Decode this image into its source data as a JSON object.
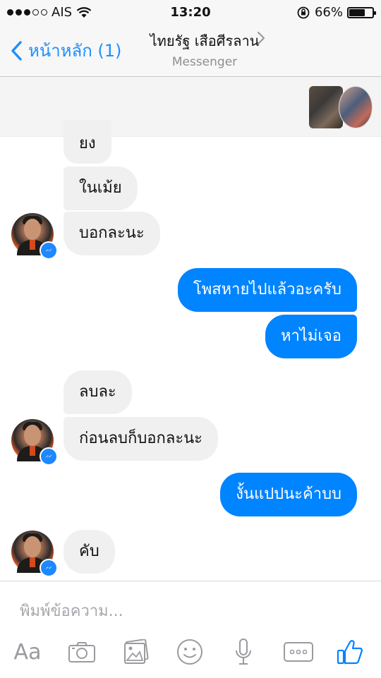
{
  "status_bar": {
    "carrier": "AIS",
    "time": "13:20",
    "battery": "66%"
  },
  "nav": {
    "back_label": "หน้าหลัก (1)",
    "title": "ไทยรัฐ เสือศีรลาน",
    "subtitle": "Messenger"
  },
  "messages": [
    {
      "dir": "in",
      "text": "ยง"
    },
    {
      "dir": "in",
      "text": "ในเม้ย"
    },
    {
      "dir": "in",
      "text": "บอกละนะ"
    },
    {
      "dir": "out",
      "text": "โพสหายไปแล้วอะครับ"
    },
    {
      "dir": "out",
      "text": "หาไม่เจอ"
    },
    {
      "dir": "in",
      "text": "ลบละ"
    },
    {
      "dir": "in",
      "text": "ก่อนลบก็บอกละนะ"
    },
    {
      "dir": "out",
      "text": "งั้นแปปนะค้าบบ"
    },
    {
      "dir": "in",
      "text": "คับ"
    }
  ],
  "composer": {
    "placeholder": "พิมพ์ข้อความ...",
    "aa_label": "Aa"
  },
  "colors": {
    "accent": "#0084ff",
    "incoming_bubble": "#f1f0f0",
    "nav_link": "#1e90ff"
  },
  "icons": [
    "signal-dots-icon",
    "wifi-icon",
    "rotation-lock-icon",
    "battery-icon",
    "back-chevron-icon",
    "chevron-right-icon",
    "messenger-badge-icon",
    "camera-icon",
    "photo-gallery-icon",
    "emoji-icon",
    "microphone-icon",
    "more-icon",
    "thumbs-up-icon"
  ]
}
